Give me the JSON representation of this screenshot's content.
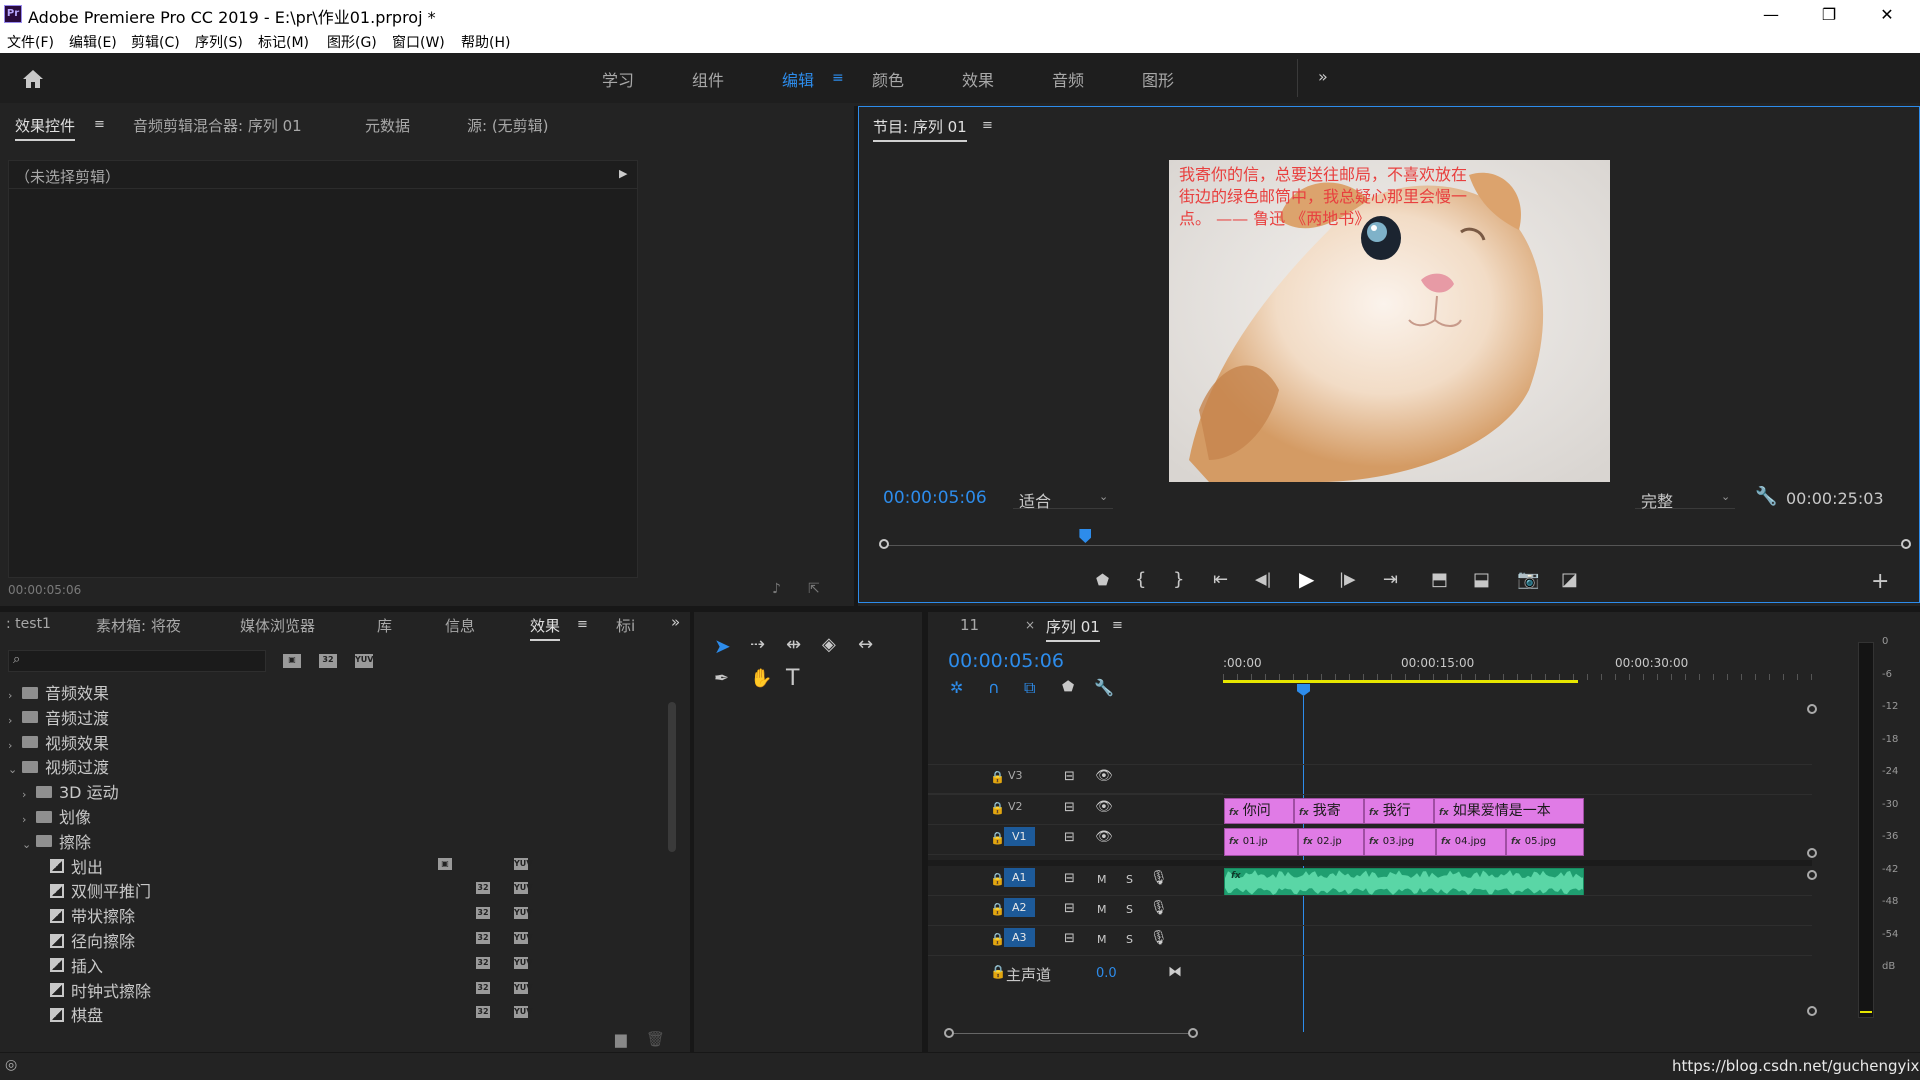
{
  "window": {
    "title": "Adobe Premiere Pro CC 2019 - E:\\pr\\作业01.prproj *",
    "logo": "Pr",
    "minimize": "—",
    "restore": "❐",
    "close": "✕"
  },
  "menu": [
    "文件(F)",
    "编辑(E)",
    "剪辑(C)",
    "序列(S)",
    "标记(M)",
    "图形(G)",
    "窗口(W)",
    "帮助(H)"
  ],
  "workspaces": {
    "items": [
      "学习",
      "组件",
      "编辑",
      "颜色",
      "效果",
      "音频",
      "图形"
    ],
    "active": "编辑",
    "more": "»"
  },
  "source_panel": {
    "tabs": [
      "效果控件",
      "音频剪辑混合器: 序列 01",
      "元数据",
      "源: (无剪辑)"
    ],
    "no_clip": "（未选择剪辑）",
    "timecode": "00:00:05:06"
  },
  "program_monitor": {
    "title": "节目: 序列 01",
    "overlay_text": "我寄你的信，总要送往邮局，不喜欢放在街边的绿色邮筒中，我总疑心那里会慢一点。 —— 鲁迅 《两地书》",
    "timecode": "00:00:05:06",
    "fit": "适合",
    "quality": "完整",
    "duration": "00:00:25:03",
    "playhead_fraction": 0.2
  },
  "project_panel": {
    "tabs": [
      ": test1",
      "素材箱: 将夜",
      "媒体浏览器",
      "库",
      "信息",
      "效果",
      "标i"
    ],
    "active_tab": "效果",
    "search_placeholder": "",
    "tree": [
      {
        "label": "音频效果",
        "level": 0,
        "type": "folder",
        "expanded": false
      },
      {
        "label": "音频过渡",
        "level": 0,
        "type": "folder",
        "expanded": false
      },
      {
        "label": "视频效果",
        "level": 0,
        "type": "folder",
        "expanded": false
      },
      {
        "label": "视频过渡",
        "level": 0,
        "type": "folder",
        "expanded": true
      },
      {
        "label": "3D 运动",
        "level": 1,
        "type": "folder",
        "expanded": false
      },
      {
        "label": "划像",
        "level": 1,
        "type": "folder",
        "expanded": false
      },
      {
        "label": "擦除",
        "level": 1,
        "type": "folder",
        "expanded": true
      },
      {
        "label": "划出",
        "level": 2,
        "type": "effect"
      },
      {
        "label": "双侧平推门",
        "level": 2,
        "type": "effect"
      },
      {
        "label": "带状擦除",
        "level": 2,
        "type": "effect"
      },
      {
        "label": "径向擦除",
        "level": 2,
        "type": "effect"
      },
      {
        "label": "插入",
        "level": 2,
        "type": "effect"
      },
      {
        "label": "时钟式擦除",
        "level": 2,
        "type": "effect"
      },
      {
        "label": "棋盘",
        "level": 2,
        "type": "effect"
      }
    ]
  },
  "timeline": {
    "tabs": [
      "11",
      "序列 01"
    ],
    "timecode": "00:00:05:06",
    "ruler": [
      ":00:00",
      "00:00:15:00",
      "00:00:30:00"
    ],
    "tracks_video": [
      "V3",
      "V2",
      "V1"
    ],
    "tracks_audio": [
      "A1",
      "A2",
      "A3"
    ],
    "master_label": "主声道",
    "master_value": "0.0",
    "v2_clips": [
      "你问",
      "我寄",
      "我行",
      "如果爱情是一本"
    ],
    "v1_clips": [
      "01.jp",
      "02.jp",
      "03.jpg",
      "04.jpg",
      "05.jpg"
    ],
    "track_buttons": {
      "mute": "M",
      "solo": "S"
    }
  },
  "meter": {
    "labels": [
      "0",
      "-6",
      "-12",
      "-18",
      "-24",
      "-30",
      "-36",
      "-42",
      "-48",
      "-54",
      "dB"
    ]
  },
  "watermark": "https://blog.csdn.net/guchengyixin",
  "colors": {
    "accent": "#2d8ceb",
    "clip_video": "#e07be6",
    "clip_audio": "#1f9e70",
    "workarea": "#e6e600"
  }
}
